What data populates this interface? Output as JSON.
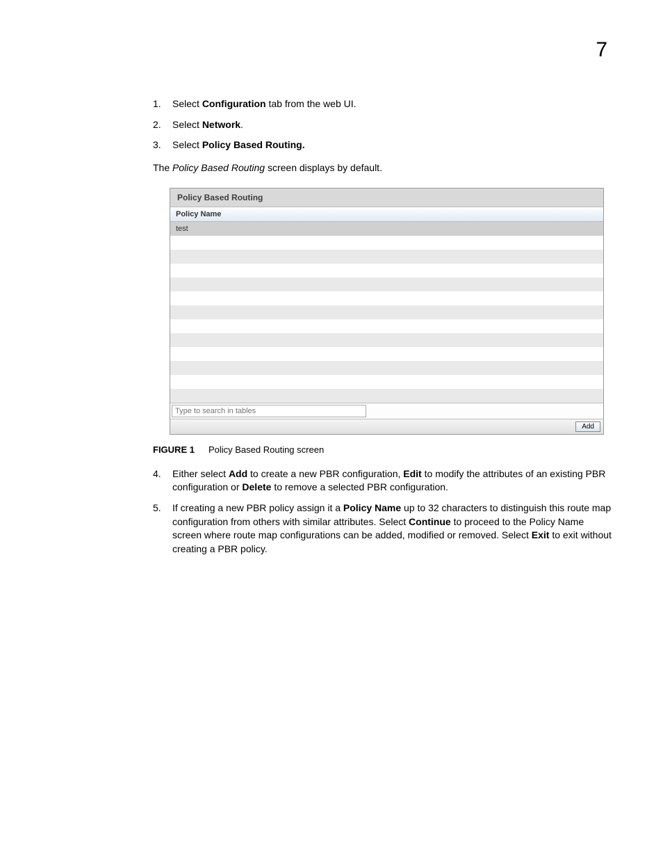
{
  "pageNumber": "7",
  "steps123": [
    {
      "num": "1.",
      "pre": "Select ",
      "bold": "Configuration",
      "post": " tab from the web UI."
    },
    {
      "num": "2.",
      "pre": "Select ",
      "bold": "Network",
      "post": "."
    },
    {
      "num": "3.",
      "pre": "Select ",
      "bold": "Policy Based Routing.",
      "post": ""
    }
  ],
  "line_after": {
    "pre": "The ",
    "italic": "Policy Based Routing",
    "post": " screen displays by default."
  },
  "panel": {
    "title": "Policy Based Routing",
    "columnHeader": "Policy Name",
    "firstRow": "test",
    "searchPlaceholder": "Type to search in tables",
    "addButton": "Add",
    "emptyRowCount": 12
  },
  "figure": {
    "label": "FIGURE 1",
    "caption": "Policy Based Routing screen"
  },
  "step4": {
    "num": "4.",
    "segments": [
      {
        "t": "Either select ",
        "b": false
      },
      {
        "t": "Add",
        "b": true
      },
      {
        "t": " to create a new PBR configuration, ",
        "b": false
      },
      {
        "t": "Edit",
        "b": true
      },
      {
        "t": " to modify the attributes of an existing PBR configuration or ",
        "b": false
      },
      {
        "t": "Delete",
        "b": true
      },
      {
        "t": " to remove a selected PBR configuration.",
        "b": false
      }
    ]
  },
  "step5": {
    "num": "5.",
    "segments": [
      {
        "t": "If creating a new PBR policy assign it a ",
        "b": false
      },
      {
        "t": "Policy Name",
        "b": true
      },
      {
        "t": " up to 32 characters to distinguish this route map configuration from others with similar attributes. Select ",
        "b": false
      },
      {
        "t": "Continue",
        "b": true
      },
      {
        "t": " to proceed to the Policy Name screen where route map configurations can be added, modified or removed. Select ",
        "b": false
      },
      {
        "t": "Exit",
        "b": true
      },
      {
        "t": " to exit without creating a PBR policy.",
        "b": false
      }
    ]
  }
}
